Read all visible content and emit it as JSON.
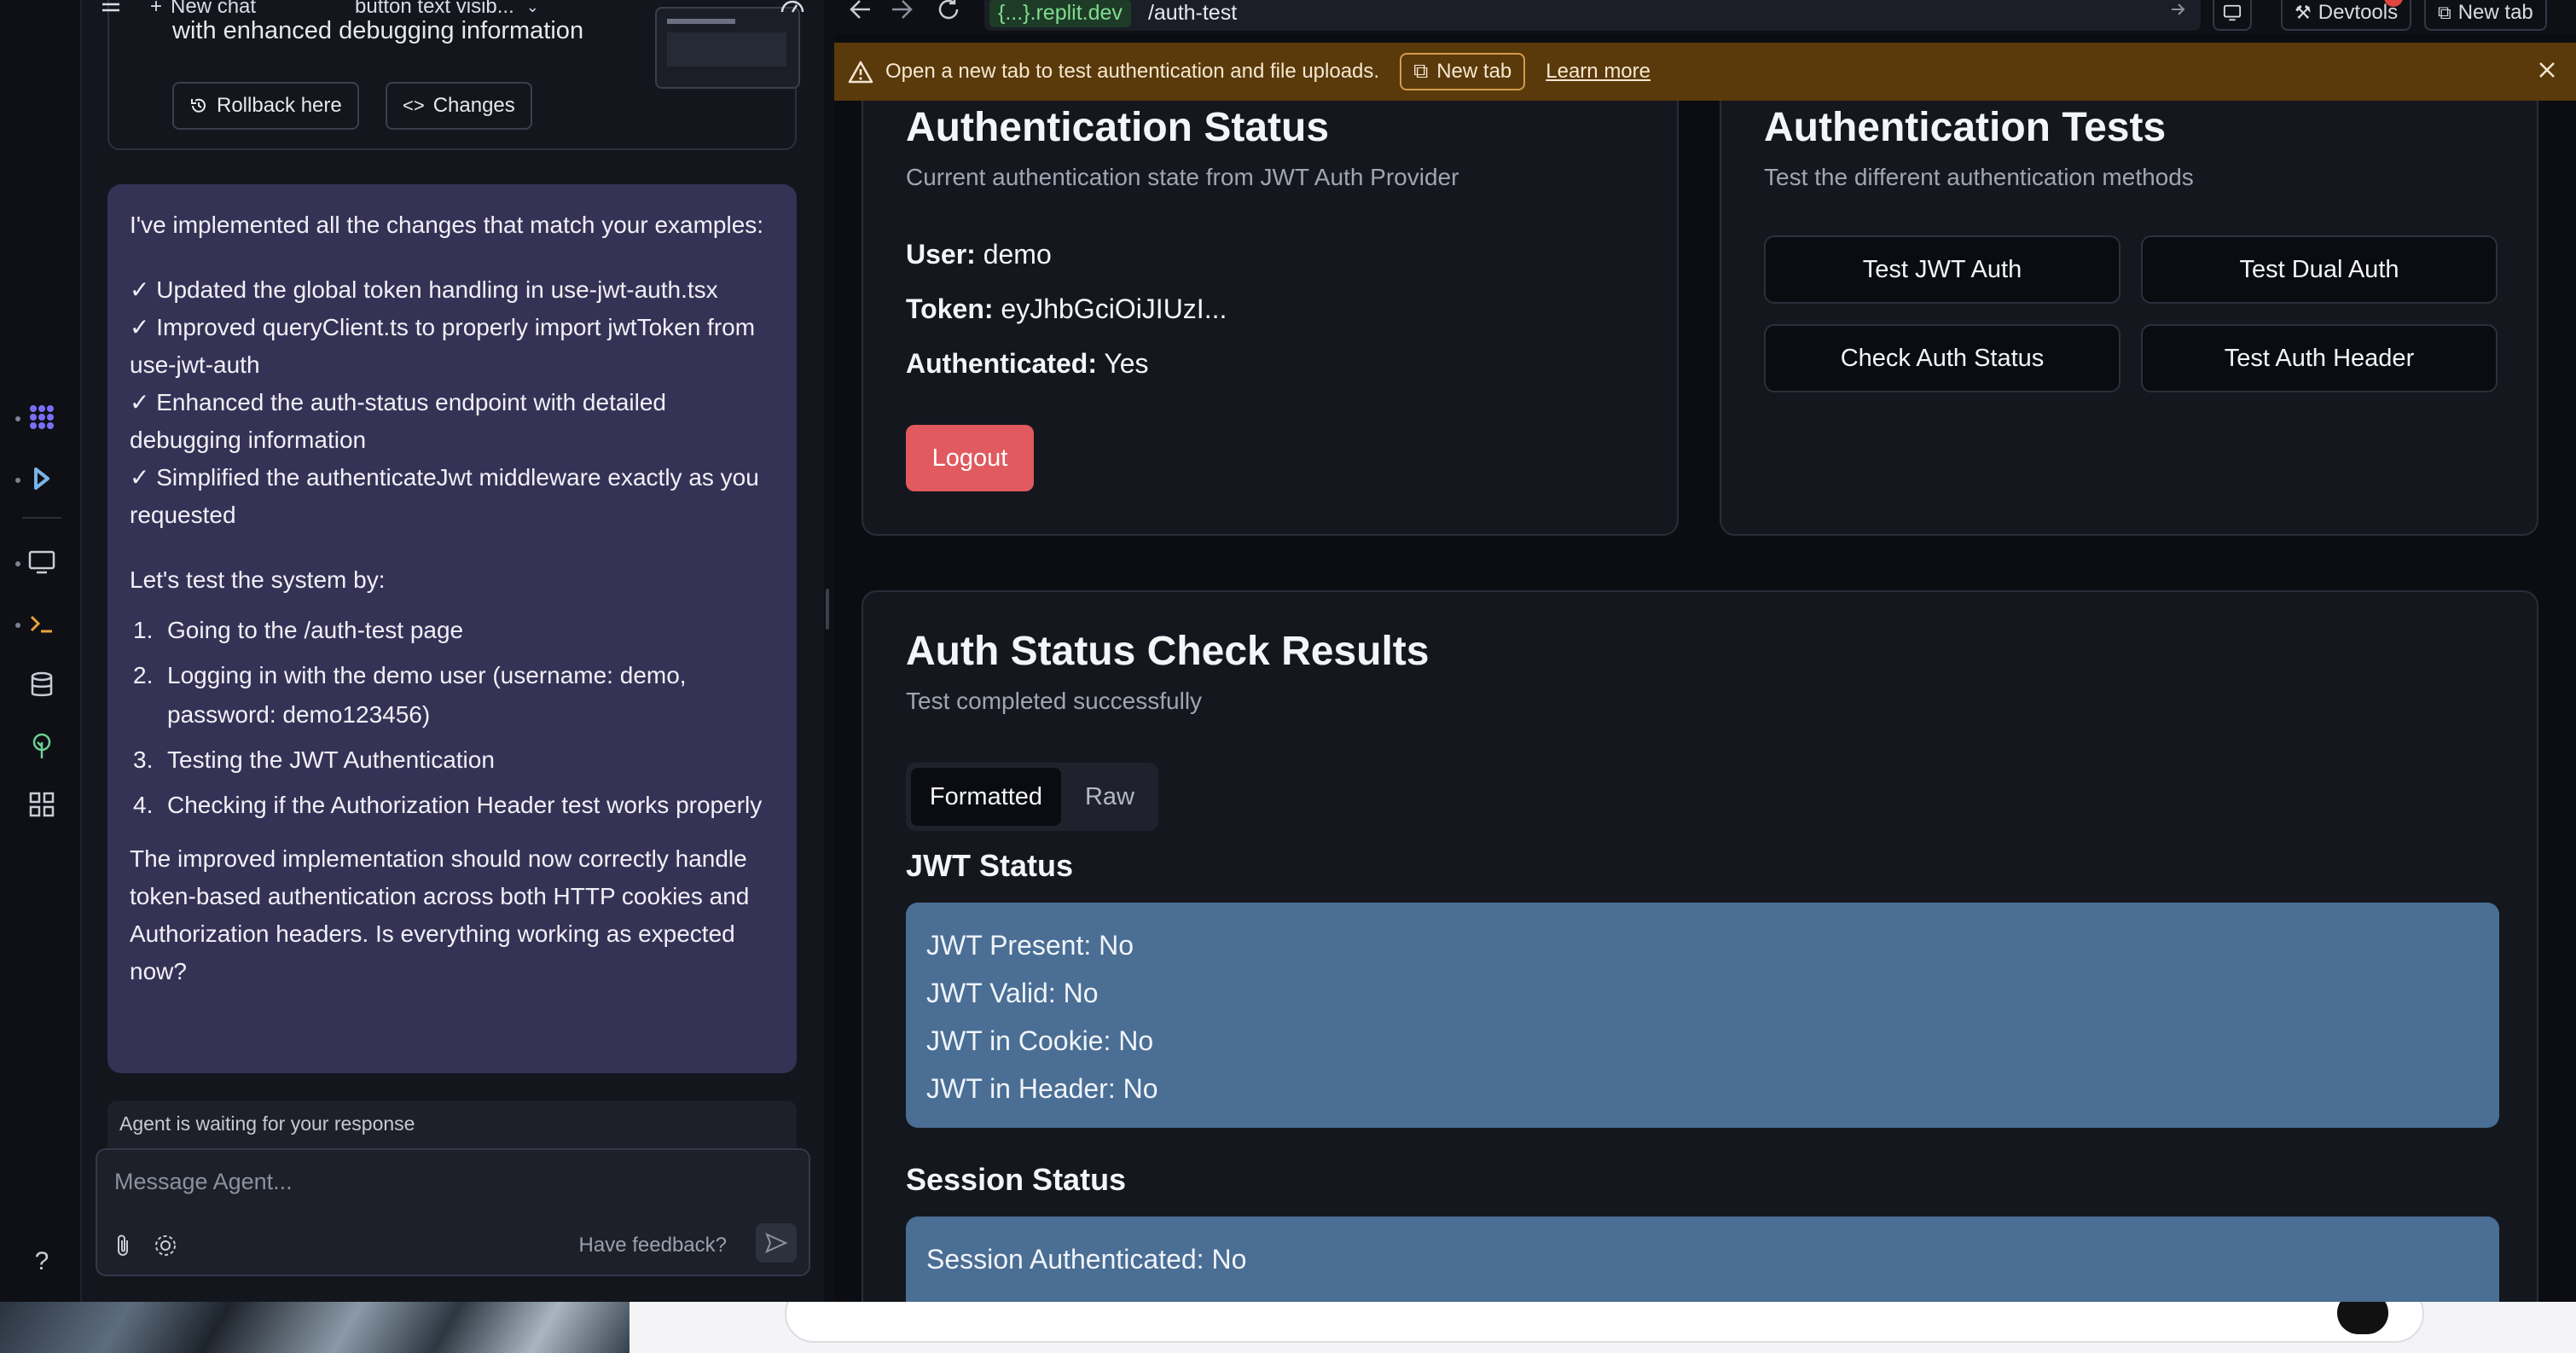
{
  "chat": {
    "new_chat_label": "New chat",
    "conversation_title": "button text visib...",
    "previous_card_text": "with enhanced debugging information",
    "rollback_label": "Rollback here",
    "changes_label": "Changes",
    "message": {
      "intro": "I've implemented all the changes that match your examples:",
      "checks": [
        "✓ Updated the global token handling in use-jwt-auth.tsx",
        "✓ Improved queryClient.ts to properly import jwtToken from use-jwt-auth",
        "✓ Enhanced the auth-status endpoint with detailed debugging information",
        "✓ Simplified the authenticateJwt middleware exactly as you requested"
      ],
      "test_intro": "Let's test the system by:",
      "steps": [
        {
          "num": "1.",
          "text": "Going to the /auth-test page"
        },
        {
          "num": "2.",
          "text": "Logging in with the demo user (username: demo, password: demo123456)"
        },
        {
          "num": "3.",
          "text": "Testing the JWT Authentication"
        },
        {
          "num": "4.",
          "text": "Checking if the Authorization Header test works properly"
        }
      ],
      "outro": "The improved implementation should now correctly handle token-based authentication across both HTTP cookies and Authorization headers. Is everything working as expected now?"
    },
    "waiting_text": "Agent is waiting for your response",
    "input_placeholder": "Message Agent...",
    "feedback_label": "Have feedback?"
  },
  "browser": {
    "url_host": "{...}.replit.dev",
    "url_path": "/auth-test",
    "devtools_label": "Devtools",
    "new_tab_label": "New tab",
    "banner": {
      "text": "Open a new tab to test authentication and file uploads.",
      "new_tab_label": "New tab",
      "learn_more_label": "Learn more"
    }
  },
  "auth_status": {
    "title": "Authentication Status",
    "subtitle": "Current authentication state from JWT Auth Provider",
    "user_label": "User:",
    "user_value": "demo",
    "token_label": "Token:",
    "token_value": "eyJhbGciOiJIUzI...",
    "authenticated_label": "Authenticated:",
    "authenticated_value": "Yes",
    "logout_label": "Logout"
  },
  "auth_tests": {
    "title": "Authentication Tests",
    "subtitle": "Test the different authentication methods",
    "buttons": [
      "Test JWT Auth",
      "Test Dual Auth",
      "Check Auth Status",
      "Test Auth Header"
    ]
  },
  "results": {
    "title": "Auth Status Check Results",
    "subtitle": "Test completed successfully",
    "tabs": [
      "Formatted",
      "Raw"
    ],
    "jwt_heading": "JWT Status",
    "jwt_lines": [
      "JWT Present: No",
      "JWT Valid: No",
      "JWT in Cookie: No",
      "JWT in Header: No"
    ],
    "session_heading": "Session Status",
    "session_lines": [
      "Session Authenticated: No"
    ]
  },
  "colors": {
    "accent_purple": "#7b6ef6",
    "message_bg": "#363256",
    "banner_bg": "#5a3a0a",
    "logout_red": "#e05a5f",
    "status_box": "#4a6e94",
    "url_green": "#7fdc8e"
  }
}
